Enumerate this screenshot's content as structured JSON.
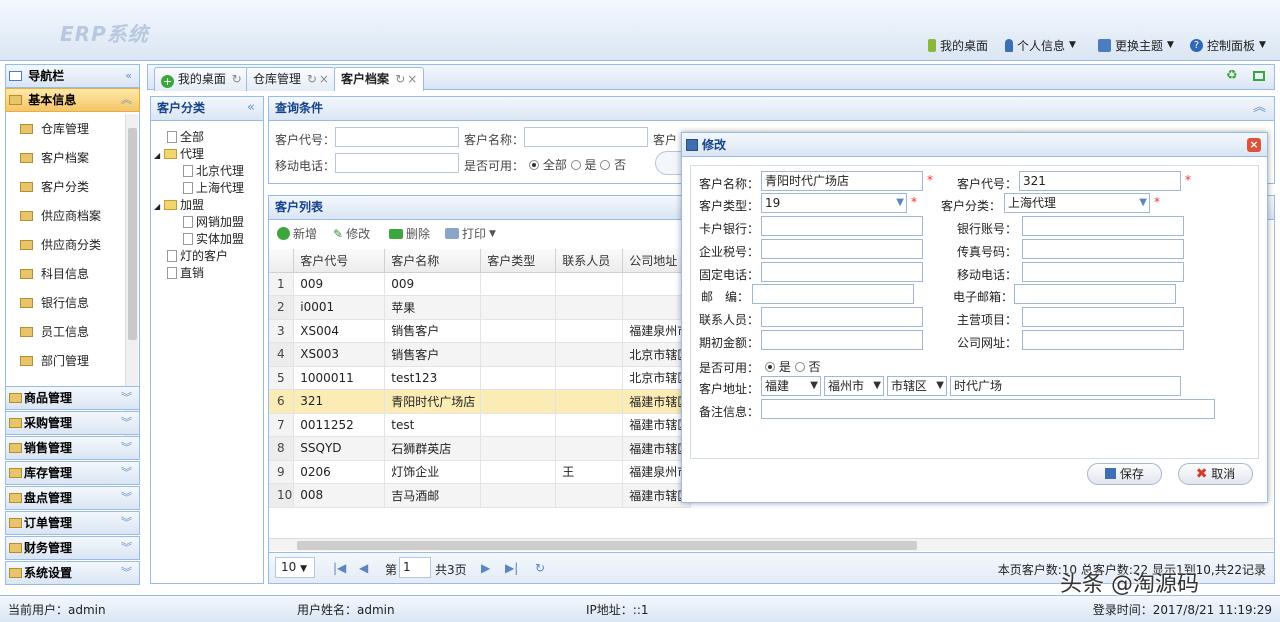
{
  "app": {
    "title": "ERP系统"
  },
  "header": {
    "nav": [
      {
        "label": "我的桌面",
        "icon": "medal-icon"
      },
      {
        "label": "个人信息",
        "icon": "user-icon",
        "dropdown": true
      },
      {
        "label": "更换主题",
        "icon": "theme-icon",
        "dropdown": true
      },
      {
        "label": "控制面板",
        "icon": "help-icon",
        "dropdown": true
      }
    ]
  },
  "sidebar": {
    "title": "导航栏",
    "active_section": "基本信息",
    "items": [
      "仓库管理",
      "客户档案",
      "客户分类",
      "供应商档案",
      "供应商分类",
      "科目信息",
      "银行信息",
      "员工信息",
      "部门管理"
    ],
    "sections": [
      "商品管理",
      "采购管理",
      "销售管理",
      "库存管理",
      "盘点管理",
      "订单管理",
      "财务管理",
      "系统设置"
    ]
  },
  "tabs": [
    {
      "label": "我的桌面",
      "selected": false
    },
    {
      "label": "仓库管理",
      "selected": false
    },
    {
      "label": "客户档案",
      "selected": true
    }
  ],
  "category": {
    "title": "客户分类",
    "tree": {
      "all": "全部",
      "agent": "代理",
      "beijing": "北京代理",
      "shanghai": "上海代理",
      "franchise": "加盟",
      "online": "网销加盟",
      "physical": "实体加盟",
      "lamp": "灯的客户",
      "direct": "直销"
    }
  },
  "query": {
    "title": "查询条件",
    "code_label": "客户代号：",
    "name_label": "客户名称：",
    "type_label_partial": "客户",
    "phone_label": "移动电话：",
    "enabled_label": "是否可用：",
    "opt_all": "全部",
    "opt_yes": "是",
    "opt_no": "否"
  },
  "list": {
    "title": "客户列表",
    "toolbar": {
      "add": "新增",
      "edit": "修改",
      "delete": "删除",
      "print": "打印"
    },
    "columns": [
      "客户代号",
      "客户名称",
      "客户类型",
      "联系人员",
      "公司地址"
    ],
    "rows": [
      {
        "n": "1",
        "code": "009",
        "name": "009",
        "type": "",
        "contact": "",
        "addr": ""
      },
      {
        "n": "2",
        "code": "i0001",
        "name": "苹果",
        "type": "",
        "contact": "",
        "addr": ""
      },
      {
        "n": "3",
        "code": "XS004",
        "name": "销售客户",
        "type": "",
        "contact": "",
        "addr": "福建泉州市"
      },
      {
        "n": "4",
        "code": "XS003",
        "name": "销售客户",
        "type": "",
        "contact": "",
        "addr": "北京市辖区"
      },
      {
        "n": "5",
        "code": "1000011",
        "name": "test123",
        "type": "",
        "contact": "",
        "addr": "北京市辖区"
      },
      {
        "n": "6",
        "code": "321",
        "name": "青阳时代广场店",
        "type": "",
        "contact": "",
        "addr": "福建市辖区"
      },
      {
        "n": "7",
        "code": "0011252",
        "name": "test",
        "type": "",
        "contact": "",
        "addr": "福建市辖区"
      },
      {
        "n": "8",
        "code": "SSQYD",
        "name": "石狮群英店",
        "type": "",
        "contact": "",
        "addr": "福建市辖区"
      },
      {
        "n": "9",
        "code": "0206",
        "name": "灯饰企业",
        "type": "",
        "contact": "王",
        "addr": "福建泉州市"
      },
      {
        "n": "10",
        "code": "008",
        "name": "吉马酒邮",
        "type": "",
        "contact": "",
        "addr": "福建市辖区"
      }
    ],
    "pager": {
      "page_size": "10",
      "page_label": "第",
      "page": "1",
      "total_pages": "共3页",
      "summary": "本页客户数:10 总客户数:22 显示1到10,共22记录"
    }
  },
  "modal": {
    "title": "修改",
    "fields": {
      "name_label": "客户名称：",
      "name_value": "青阳时代广场店",
      "code_label": "客户代号：",
      "code_value": "321",
      "type_label": "客户类型：",
      "type_value": "19",
      "cat_label": "客户分类：",
      "cat_value": "上海代理",
      "bank_label": "卡户银行：",
      "account_label": "银行账号：",
      "tax_label": "企业税号：",
      "fax_label": "传真号码：",
      "tel_label": "固定电话：",
      "mobile_label": "移动电话：",
      "zip_label": "邮　编：",
      "email_label": "电子邮箱：",
      "contact_label": "联系人员：",
      "project_label": "主营项目：",
      "opening_label": "期初金额：",
      "web_label": "公司网址：",
      "enabled_label": "是否可用：",
      "opt_yes": "是",
      "opt_no": "否",
      "addr_label": "客户地址：",
      "province": "福建",
      "city": "福州市",
      "district": "市辖区",
      "street": "时代广场",
      "remark_label": "备注信息："
    },
    "save": "保存",
    "cancel": "取消"
  },
  "status": {
    "current_user": "当前用户：admin",
    "user_name": "用户姓名：admin",
    "ip": "IP地址：::1",
    "login_time": "登录时间：2017/8/21 11:19:29"
  },
  "watermark": "头条 @淘源码",
  "colors": {
    "border": "#99bbe8",
    "accent": "#15428b",
    "highlight_row": "#fbecb5"
  }
}
